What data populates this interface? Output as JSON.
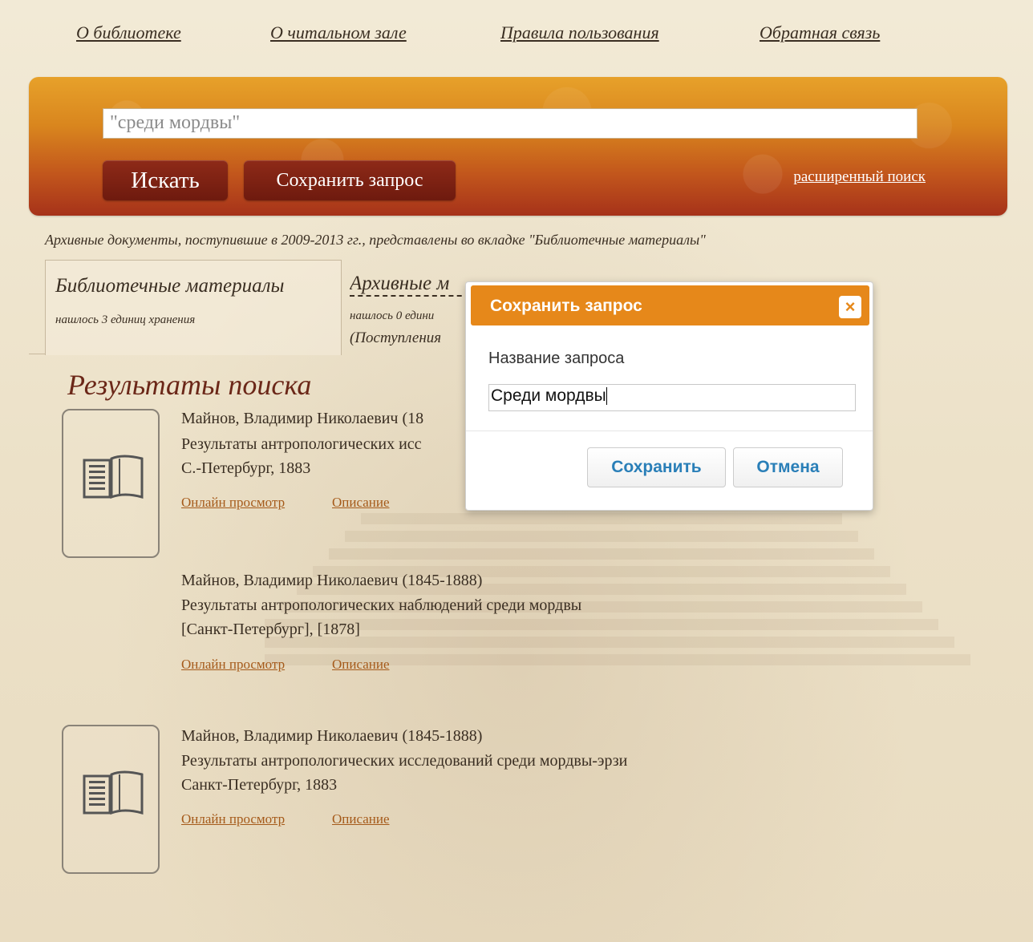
{
  "nav": {
    "about": "О библиотеке",
    "reading_room": "О читальном зале",
    "rules": "Правила пользования",
    "feedback": "Обратная связь"
  },
  "search": {
    "value": "\"среди мордвы\"",
    "search_button": "Искать",
    "save_button": "Сохранить запрос",
    "advanced_link": "расширенный поиск"
  },
  "notice": "Архивные документы, поступившие в 2009-2013 гг., представлены во вкладке \"Библиотечные материалы\"",
  "tabs": [
    {
      "title": "Библиотечные материалы",
      "subtitle": "нашлось 3 единиц хранения"
    },
    {
      "title": "Архивные м",
      "subtitle": "нашлось 0 едини",
      "extra": "(Поступления"
    }
  ],
  "results_title": "Результаты поиска",
  "results": [
    {
      "author": "Майнов, Владимир Николаевич (18",
      "title": "Результаты антропологических исс",
      "place": "С.-Петербург, 1883",
      "online": "Онлайн просмотр",
      "description": "Описание"
    },
    {
      "author": "Майнов, Владимир Николаевич (1845-1888)",
      "title": "Результаты антропологических наблюдений среди мордвы",
      "place": "[Санкт-Петербург], [1878]",
      "online": "Онлайн просмотр",
      "description": "Описание"
    },
    {
      "author": "Майнов, Владимир Николаевич (1845-1888)",
      "title": "Результаты антропологических исследований среди мордвы-эрзи",
      "place": "Санкт-Петербург, 1883",
      "online": "Онлайн просмотр",
      "description": "Описание"
    }
  ],
  "modal": {
    "title": "Сохранить запрос",
    "close_icon": "×",
    "label": "Название запроса",
    "input_value": "Среди мордвы",
    "save": "Сохранить",
    "cancel": "Отмена"
  },
  "colors": {
    "banner_top": "#e7a12a",
    "banner_bottom": "#a6321a",
    "modal_header": "#e6881a",
    "link": "#a55a1a",
    "button_text": "#2a7fb8"
  }
}
